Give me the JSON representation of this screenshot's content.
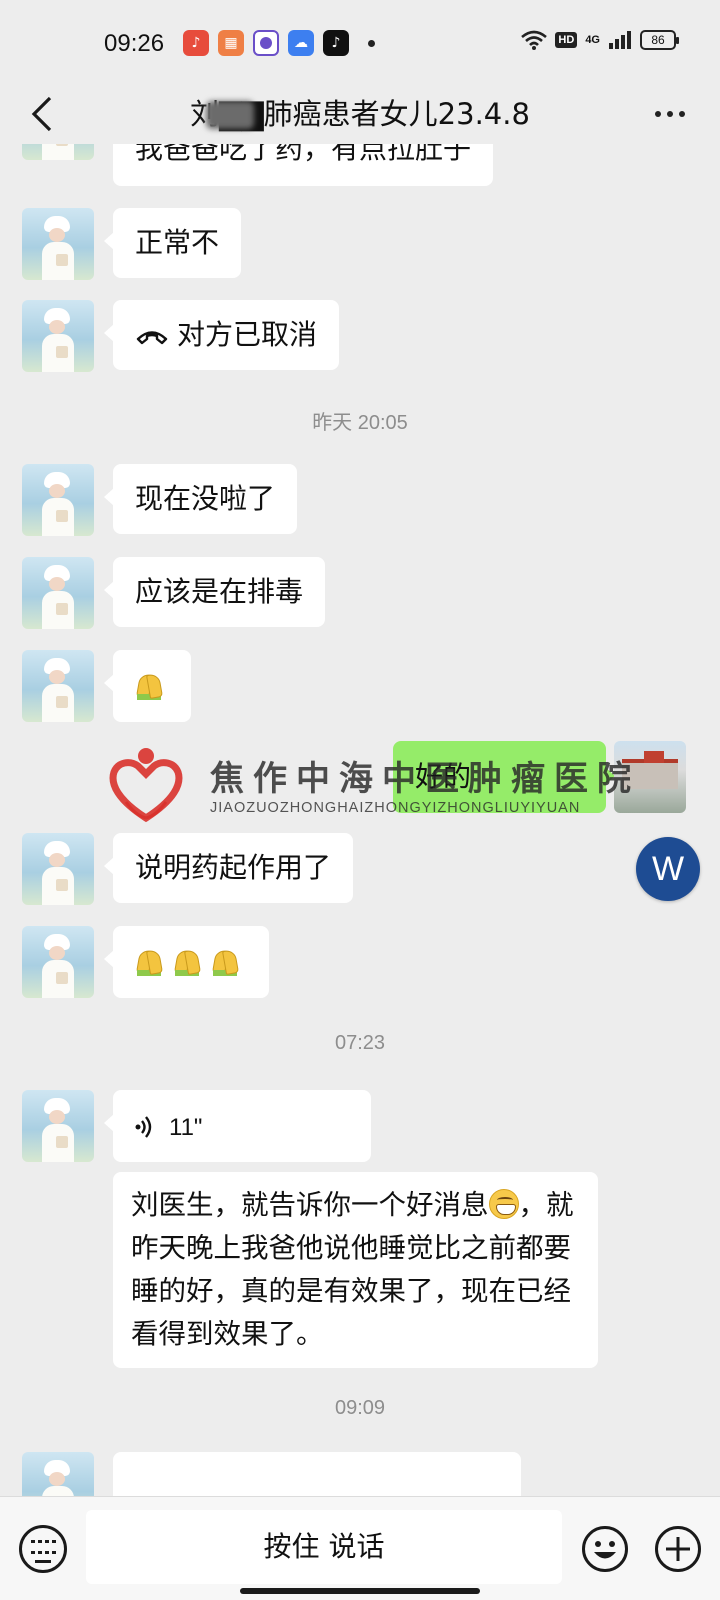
{
  "status_bar": {
    "time": "09:26",
    "battery": "86",
    "net_badge": "HD",
    "signal_label": "4G",
    "app_icons": [
      "music-icon",
      "multi-app-icon",
      "browser-icon",
      "cloud-icon",
      "tiktok-icon"
    ]
  },
  "header": {
    "title": "刘 ▇ 肺癌患者女儿23.4.8",
    "title_visible": "刘▇▇肺癌患者女儿23.4.8"
  },
  "messages": {
    "m0": "我爸爸吃了药，有点拉肚子",
    "m1": "正常不",
    "m2": "对方已取消",
    "t1": "昨天 20:05",
    "m3": "现在没啦了",
    "m4": "应该是在排毒",
    "m6_out": "好的",
    "m7": "说明药起作用了",
    "t2": "07:23",
    "voice_len": "11\"",
    "m9_a": "刘医生，就告诉你一个好消息",
    "m9_b": "，就昨天晚上我爸他说他睡觉比之前都要睡的好，真的是有效果了，现在已经看得到效果了。",
    "t3": "09:09"
  },
  "watermark": {
    "name": "焦作中海中医肿瘤医院",
    "pinyin": "JIAOZUOZHONGHAIZHONGYIZHONGLIUYIYUAN"
  },
  "fab": {
    "letter": "W"
  },
  "input_bar": {
    "hold_to_talk": "按住 说话"
  },
  "colors": {
    "bg": "#ededed",
    "bubble_in": "#ffffff",
    "bubble_out": "#95ec69",
    "fab": "#1e4c93",
    "logo_red": "#d8312b"
  }
}
